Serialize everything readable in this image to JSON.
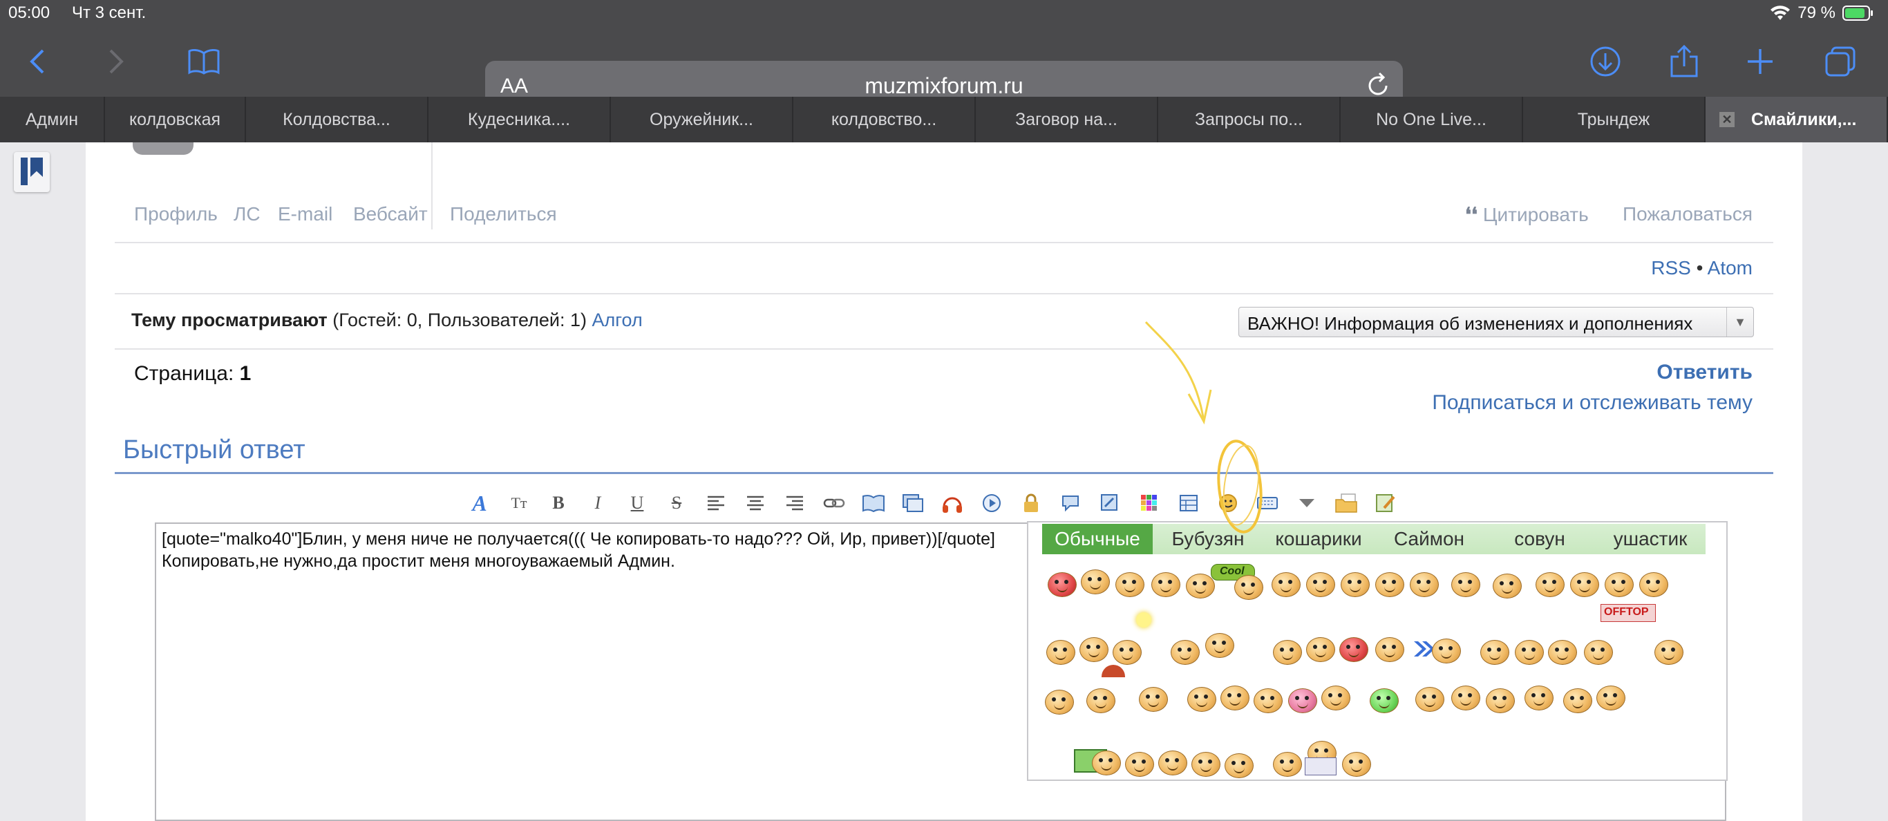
{
  "status": {
    "time": "05:00",
    "date": "Чт 3 сент.",
    "battery": "79 %"
  },
  "browser": {
    "aa": "AA",
    "url": "muzmixforum.ru"
  },
  "tabs": [
    {
      "label": "Админ"
    },
    {
      "label": "колдовская"
    },
    {
      "label": "Колдовства..."
    },
    {
      "label": "Кудесника...."
    },
    {
      "label": "Оружейник..."
    },
    {
      "label": "колдовство..."
    },
    {
      "label": "Заговор на..."
    },
    {
      "label": "Запросы по..."
    },
    {
      "label": "No One Live..."
    },
    {
      "label": "Трындеж"
    },
    {
      "label": "Смайлики,..."
    }
  ],
  "post_links": {
    "profile": "Профиль",
    "pm": "ЛС",
    "email": "E-mail",
    "website": "Вебсайт",
    "share": "Поделиться",
    "quote": "Цитировать",
    "report": "Пожаловаться"
  },
  "feeds": {
    "rss": "RSS",
    "sep": "•",
    "atom": "Atom"
  },
  "viewers": {
    "label": "Тему просматривают",
    "counts": "(Гостей: 0, Пользователей: 1)",
    "user": "Алгол"
  },
  "jump_select": {
    "value": "ВАЖНО! Информация об изменениях и дополнениях"
  },
  "pagination": {
    "label": "Страница:",
    "page": "1"
  },
  "actions": {
    "reply": "Ответить",
    "subscribe": "Подписаться и отслеживать тему"
  },
  "quick_reply": {
    "title": "Быстрый ответ"
  },
  "editor": {
    "line1": "[quote=\"malko40\"]Блин, у меня ниче не получается((( Че копировать-то надо??? Ой, Ир, привет))[/quote]",
    "line2": "Копировать,не нужно,да простит меня многоуважаемый Админ."
  },
  "smiley_tabs": [
    {
      "label": "Обычные"
    },
    {
      "label": "Бубузян"
    },
    {
      "label": "кошарики"
    },
    {
      "label": "Саймон"
    },
    {
      "label": "совун"
    },
    {
      "label": "ушастик"
    }
  ],
  "badges": {
    "cool": "Cool",
    "offtop": "OFFTOP"
  },
  "toolbar_glyphs": {
    "font": "A",
    "size": "Tт",
    "bold": "B",
    "italic": "I",
    "underline": "U",
    "strike": "S"
  }
}
